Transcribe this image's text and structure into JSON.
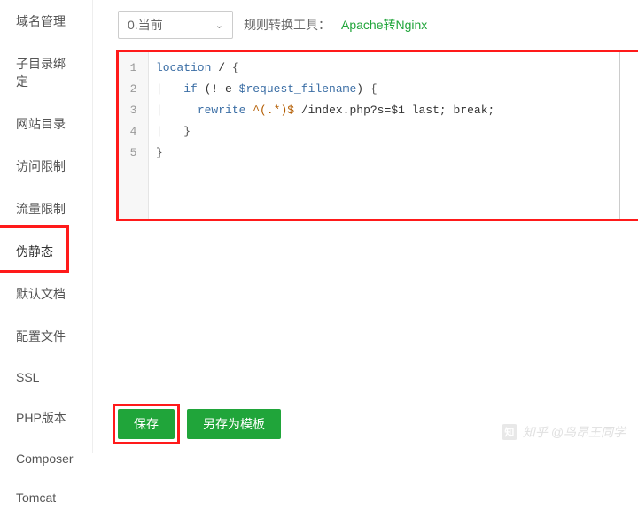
{
  "sidebar": {
    "items": [
      {
        "label": "域名管理"
      },
      {
        "label": "子目录绑定"
      },
      {
        "label": "网站目录"
      },
      {
        "label": "访问限制"
      },
      {
        "label": "流量限制"
      },
      {
        "label": "伪静态",
        "active": true
      },
      {
        "label": "默认文档"
      },
      {
        "label": "配置文件"
      },
      {
        "label": "SSL"
      },
      {
        "label": "PHP版本"
      },
      {
        "label": "Composer"
      },
      {
        "label": "Tomcat"
      }
    ]
  },
  "top": {
    "select_value": "0.当前",
    "label": "规则转换工具：",
    "link": "Apache转Nginx"
  },
  "editor": {
    "line_numbers": [
      "1",
      "2",
      "3",
      "4",
      "5"
    ],
    "lines": [
      {
        "tokens": [
          {
            "cls": "kw",
            "t": "location"
          },
          {
            "cls": "plain",
            "t": " / "
          },
          {
            "cls": "punc",
            "t": "{"
          }
        ]
      },
      {
        "tokens": [
          {
            "cls": "indent-guide",
            "t": "|   "
          },
          {
            "cls": "kw",
            "t": "if"
          },
          {
            "cls": "plain",
            "t": " (!-e "
          },
          {
            "cls": "var",
            "t": "$request_filename"
          },
          {
            "cls": "plain",
            "t": ") "
          },
          {
            "cls": "punc",
            "t": "{"
          }
        ]
      },
      {
        "tokens": [
          {
            "cls": "indent-guide",
            "t": "|   "
          },
          {
            "cls": "indent-guide",
            "t": "  "
          },
          {
            "cls": "kw",
            "t": "rewrite"
          },
          {
            "cls": "plain",
            "t": " "
          },
          {
            "cls": "reg",
            "t": "^(.*)$"
          },
          {
            "cls": "plain",
            "t": " /index.php?s=$1 last; break;"
          }
        ]
      },
      {
        "tokens": [
          {
            "cls": "indent-guide",
            "t": "|   "
          },
          {
            "cls": "punc",
            "t": "}"
          }
        ]
      },
      {
        "tokens": [
          {
            "cls": "punc",
            "t": "}"
          }
        ]
      }
    ]
  },
  "buttons": {
    "save": "保存",
    "save_as": "另存为模板"
  },
  "watermark": {
    "icon": "知",
    "text": "知乎 @鸟昂王同学"
  }
}
